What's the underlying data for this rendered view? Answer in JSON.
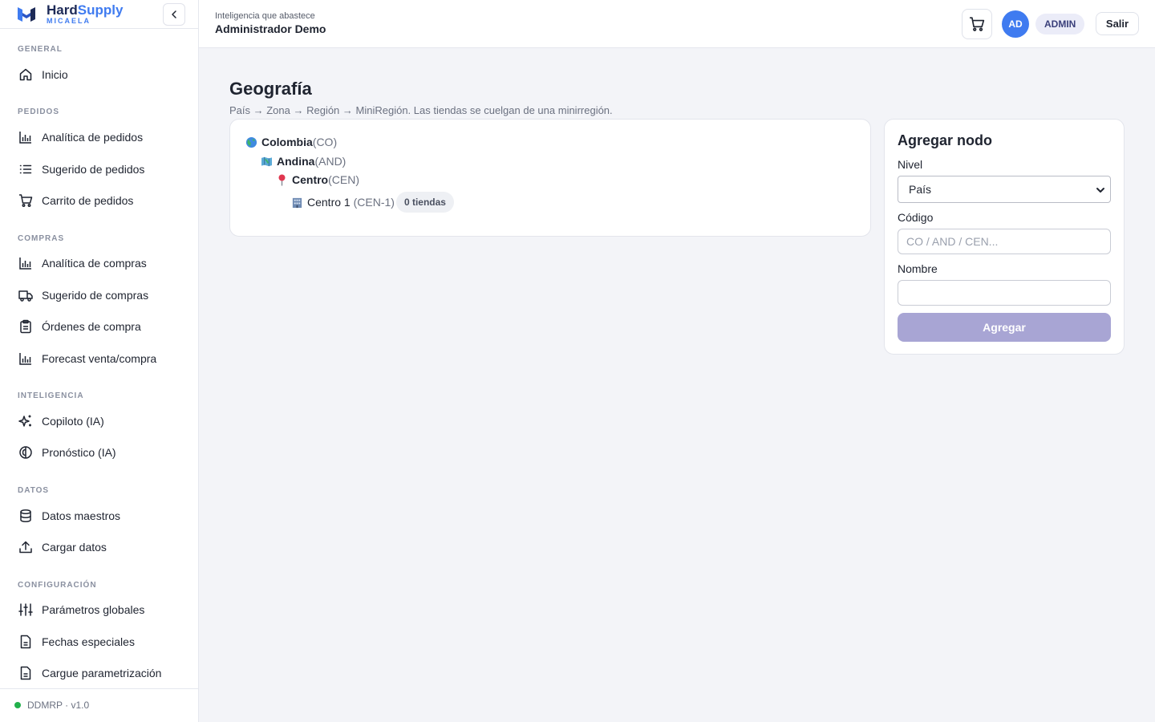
{
  "brand": {
    "name_part1": "Hard",
    "name_part2": "Supply",
    "subtitle": "MICAELA"
  },
  "sidebar": {
    "sections": [
      {
        "title": "GENERAL",
        "items": [
          {
            "label": "Inicio",
            "icon": "home-icon"
          }
        ]
      },
      {
        "title": "PEDIDOS",
        "items": [
          {
            "label": "Analítica de pedidos",
            "icon": "bar-chart-icon"
          },
          {
            "label": "Sugerido de pedidos",
            "icon": "list-icon"
          },
          {
            "label": "Carrito de pedidos",
            "icon": "cart-icon"
          }
        ]
      },
      {
        "title": "COMPRAS",
        "items": [
          {
            "label": "Analítica de compras",
            "icon": "bar-chart-icon"
          },
          {
            "label": "Sugerido de compras",
            "icon": "truck-icon"
          },
          {
            "label": "Órdenes de compra",
            "icon": "clipboard-icon"
          },
          {
            "label": "Forecast venta/compra",
            "icon": "bar-chart-icon"
          }
        ]
      },
      {
        "title": "INTELIGENCIA",
        "items": [
          {
            "label": "Copiloto (IA)",
            "icon": "sparkles-icon"
          },
          {
            "label": "Pronóstico (IA)",
            "icon": "brain-icon"
          }
        ]
      },
      {
        "title": "DATOS",
        "items": [
          {
            "label": "Datos maestros",
            "icon": "database-icon"
          },
          {
            "label": "Cargar datos",
            "icon": "upload-icon"
          }
        ]
      },
      {
        "title": "CONFIGURACIÓN",
        "items": [
          {
            "label": "Parámetros globales",
            "icon": "sliders-icon"
          },
          {
            "label": "Fechas especiales",
            "icon": "file-icon"
          },
          {
            "label": "Cargue parametrización",
            "icon": "file-icon"
          }
        ]
      }
    ],
    "footer": {
      "version": "DDMRP · v1.0",
      "status_color": "#22b04b"
    }
  },
  "header": {
    "subtitle": "Inteligencia que abastece",
    "title": "Administrador Demo",
    "avatar_initials": "AD",
    "role": "ADMIN",
    "logout_label": "Salir"
  },
  "page": {
    "title": "Geografía",
    "subtitle": "País → Zona → Región → MiniRegión. Las tiendas se cuelgan de una minirregión."
  },
  "tree": {
    "country": {
      "name": "Colombia",
      "code": "(CO)",
      "icon": "globe-icon"
    },
    "zone": {
      "name": "Andina",
      "code": "(AND)",
      "icon": "map-icon"
    },
    "region": {
      "name": "Centro",
      "code": "(CEN)",
      "icon": "pin-icon"
    },
    "miniregion": {
      "name": "Centro 1",
      "code": "(CEN-1)",
      "icon": "building-icon",
      "stores": "0 tiendas"
    }
  },
  "form": {
    "title": "Agregar nodo",
    "level_label": "Nivel",
    "level_value": "País",
    "code_label": "Código",
    "code_placeholder": "CO / AND / CEN...",
    "name_label": "Nombre",
    "name_value": "",
    "submit_label": "Agregar"
  },
  "colors": {
    "accent": "#3f7bf0",
    "brand_dark": "#1d2a57",
    "button_disabled": "#a8a5d4"
  }
}
